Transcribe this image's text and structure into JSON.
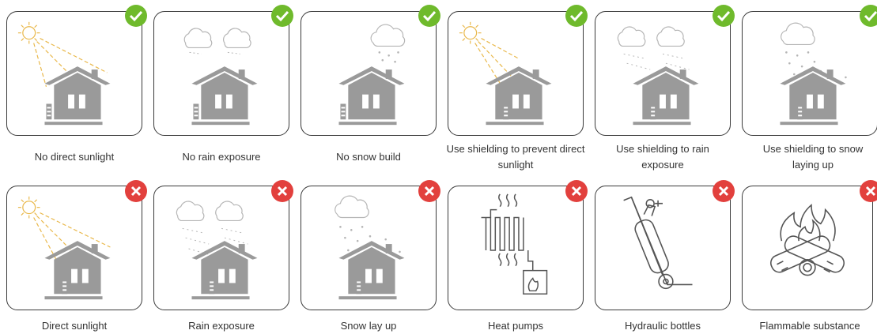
{
  "colors": {
    "ok": "#6fba2c",
    "bad": "#e2403d",
    "house": "#9a9a9a",
    "sun": "#e9b84a",
    "cloud": "#b5b5b5",
    "border": "#3a3a3a"
  },
  "allowed": [
    {
      "label": "No direct sunlight",
      "icon": "house-sun-icon",
      "status": "check-icon"
    },
    {
      "label": "No rain exposure",
      "icon": "house-rain-icon",
      "status": "check-icon"
    },
    {
      "label": "No snow build",
      "icon": "house-snow-icon",
      "status": "check-icon"
    },
    {
      "label": "Use shielding to prevent direct sunlight",
      "icon": "house-sun-shield-icon",
      "status": "check-icon"
    },
    {
      "label": "Use shielding to rain exposure",
      "icon": "house-rain-shield-icon",
      "status": "check-icon"
    },
    {
      "label": "Use shielding to snow laying up",
      "icon": "house-snow-shield-icon",
      "status": "check-icon"
    }
  ],
  "forbidden": [
    {
      "label": "Direct sunlight",
      "icon": "house-sun-icon",
      "status": "cross-icon"
    },
    {
      "label": "Rain exposure",
      "icon": "house-rain-icon",
      "status": "cross-icon"
    },
    {
      "label": "Snow lay up",
      "icon": "house-snow-icon",
      "status": "cross-icon"
    },
    {
      "label": "Heat pumps",
      "icon": "heat-pump-icon",
      "status": "cross-icon"
    },
    {
      "label": "Hydraulic bottles",
      "icon": "gas-cylinder-trolley-icon",
      "status": "cross-icon"
    },
    {
      "label": "Flammable substance",
      "icon": "fire-logs-icon",
      "status": "cross-icon"
    }
  ]
}
